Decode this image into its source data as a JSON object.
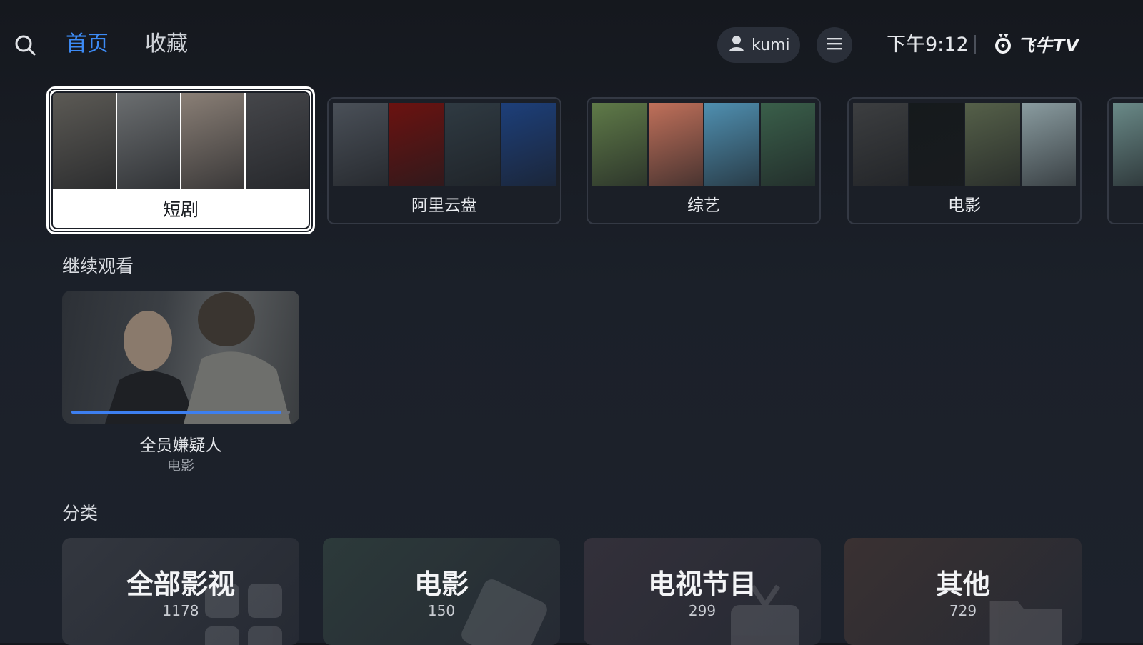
{
  "header": {
    "tabs": [
      {
        "label": "首页",
        "active": true
      },
      {
        "label": "收藏",
        "active": false
      }
    ],
    "user": {
      "name": "kumi"
    },
    "clock": "下午9:12",
    "brand": "飞牛TV",
    "accent_color": "#3d8bf5",
    "icons": {
      "search": "search-icon",
      "user": "user-icon",
      "menu": "menu-icon",
      "brand": "brand-logo-icon"
    }
  },
  "libraries": [
    {
      "label": "短剧",
      "focused": true,
      "poster_colors": [
        "#5c5a55",
        "#6b6e70",
        "#8a7f76",
        "#45464a"
      ]
    },
    {
      "label": "阿里云盘",
      "focused": false,
      "poster_colors": [
        "#4a5058",
        "#6b1210",
        "#2f3a42",
        "#1d3f7a"
      ]
    },
    {
      "label": "综艺",
      "focused": false,
      "poster_colors": [
        "#5f7a48",
        "#c0705a",
        "#4f8fb0",
        "#3a5f4a"
      ]
    },
    {
      "label": "电影",
      "focused": false,
      "poster_colors": [
        "#3c3e40",
        "#151a1c",
        "#556049",
        "#8a9ca0"
      ]
    },
    {
      "label": "",
      "focused": false,
      "poster_colors": [
        "#6a8a88"
      ]
    }
  ],
  "continue_watching": {
    "section_title": "继续观看",
    "items": [
      {
        "title": "全员嫌疑人",
        "subtitle": "电影",
        "progress": 0.96
      }
    ]
  },
  "categories": {
    "section_title": "分类",
    "items": [
      {
        "name": "全部影视",
        "count": "1178",
        "bg": "#33373f"
      },
      {
        "name": "电影",
        "count": "150",
        "bg": "#2c3a3a"
      },
      {
        "name": "电视节目",
        "count": "299",
        "bg": "#33303a"
      },
      {
        "name": "其他",
        "count": "729",
        "bg": "#3a3132"
      }
    ]
  }
}
